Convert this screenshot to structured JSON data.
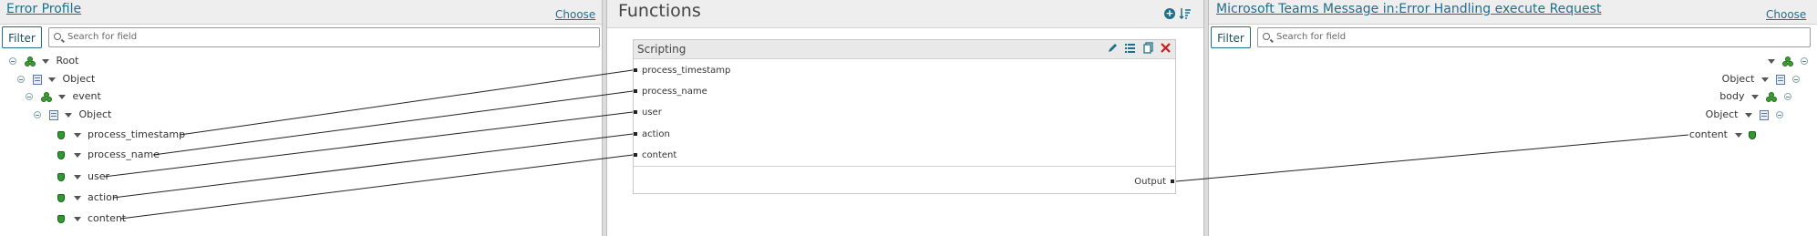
{
  "source_panel": {
    "title": "Error Profile",
    "choose_label": "Choose",
    "filter_label": "Filter",
    "search_placeholder": "Search for field",
    "tree": {
      "root": "Root",
      "object1": "Object",
      "event": "event",
      "object2": "Object",
      "fields": [
        "process_timestamp",
        "process_name",
        "user",
        "action",
        "content"
      ]
    }
  },
  "functions_panel": {
    "title": "Functions",
    "function_box": {
      "title": "Scripting",
      "inputs": [
        "process_timestamp",
        "process_name",
        "user",
        "action",
        "content"
      ],
      "output": "Output"
    }
  },
  "target_panel": {
    "title": "Microsoft Teams Message in:Error Handling execute Request",
    "choose_label": "Choose",
    "filter_label": "Filter",
    "search_placeholder": "Search for field",
    "tree": {
      "object1": "Object",
      "body": "body",
      "object2": "Object",
      "content": "content"
    }
  },
  "colors": {
    "link": "#1f6f8b",
    "accent_green": "#2e9b2e",
    "delete_red": "#d11a1a"
  }
}
